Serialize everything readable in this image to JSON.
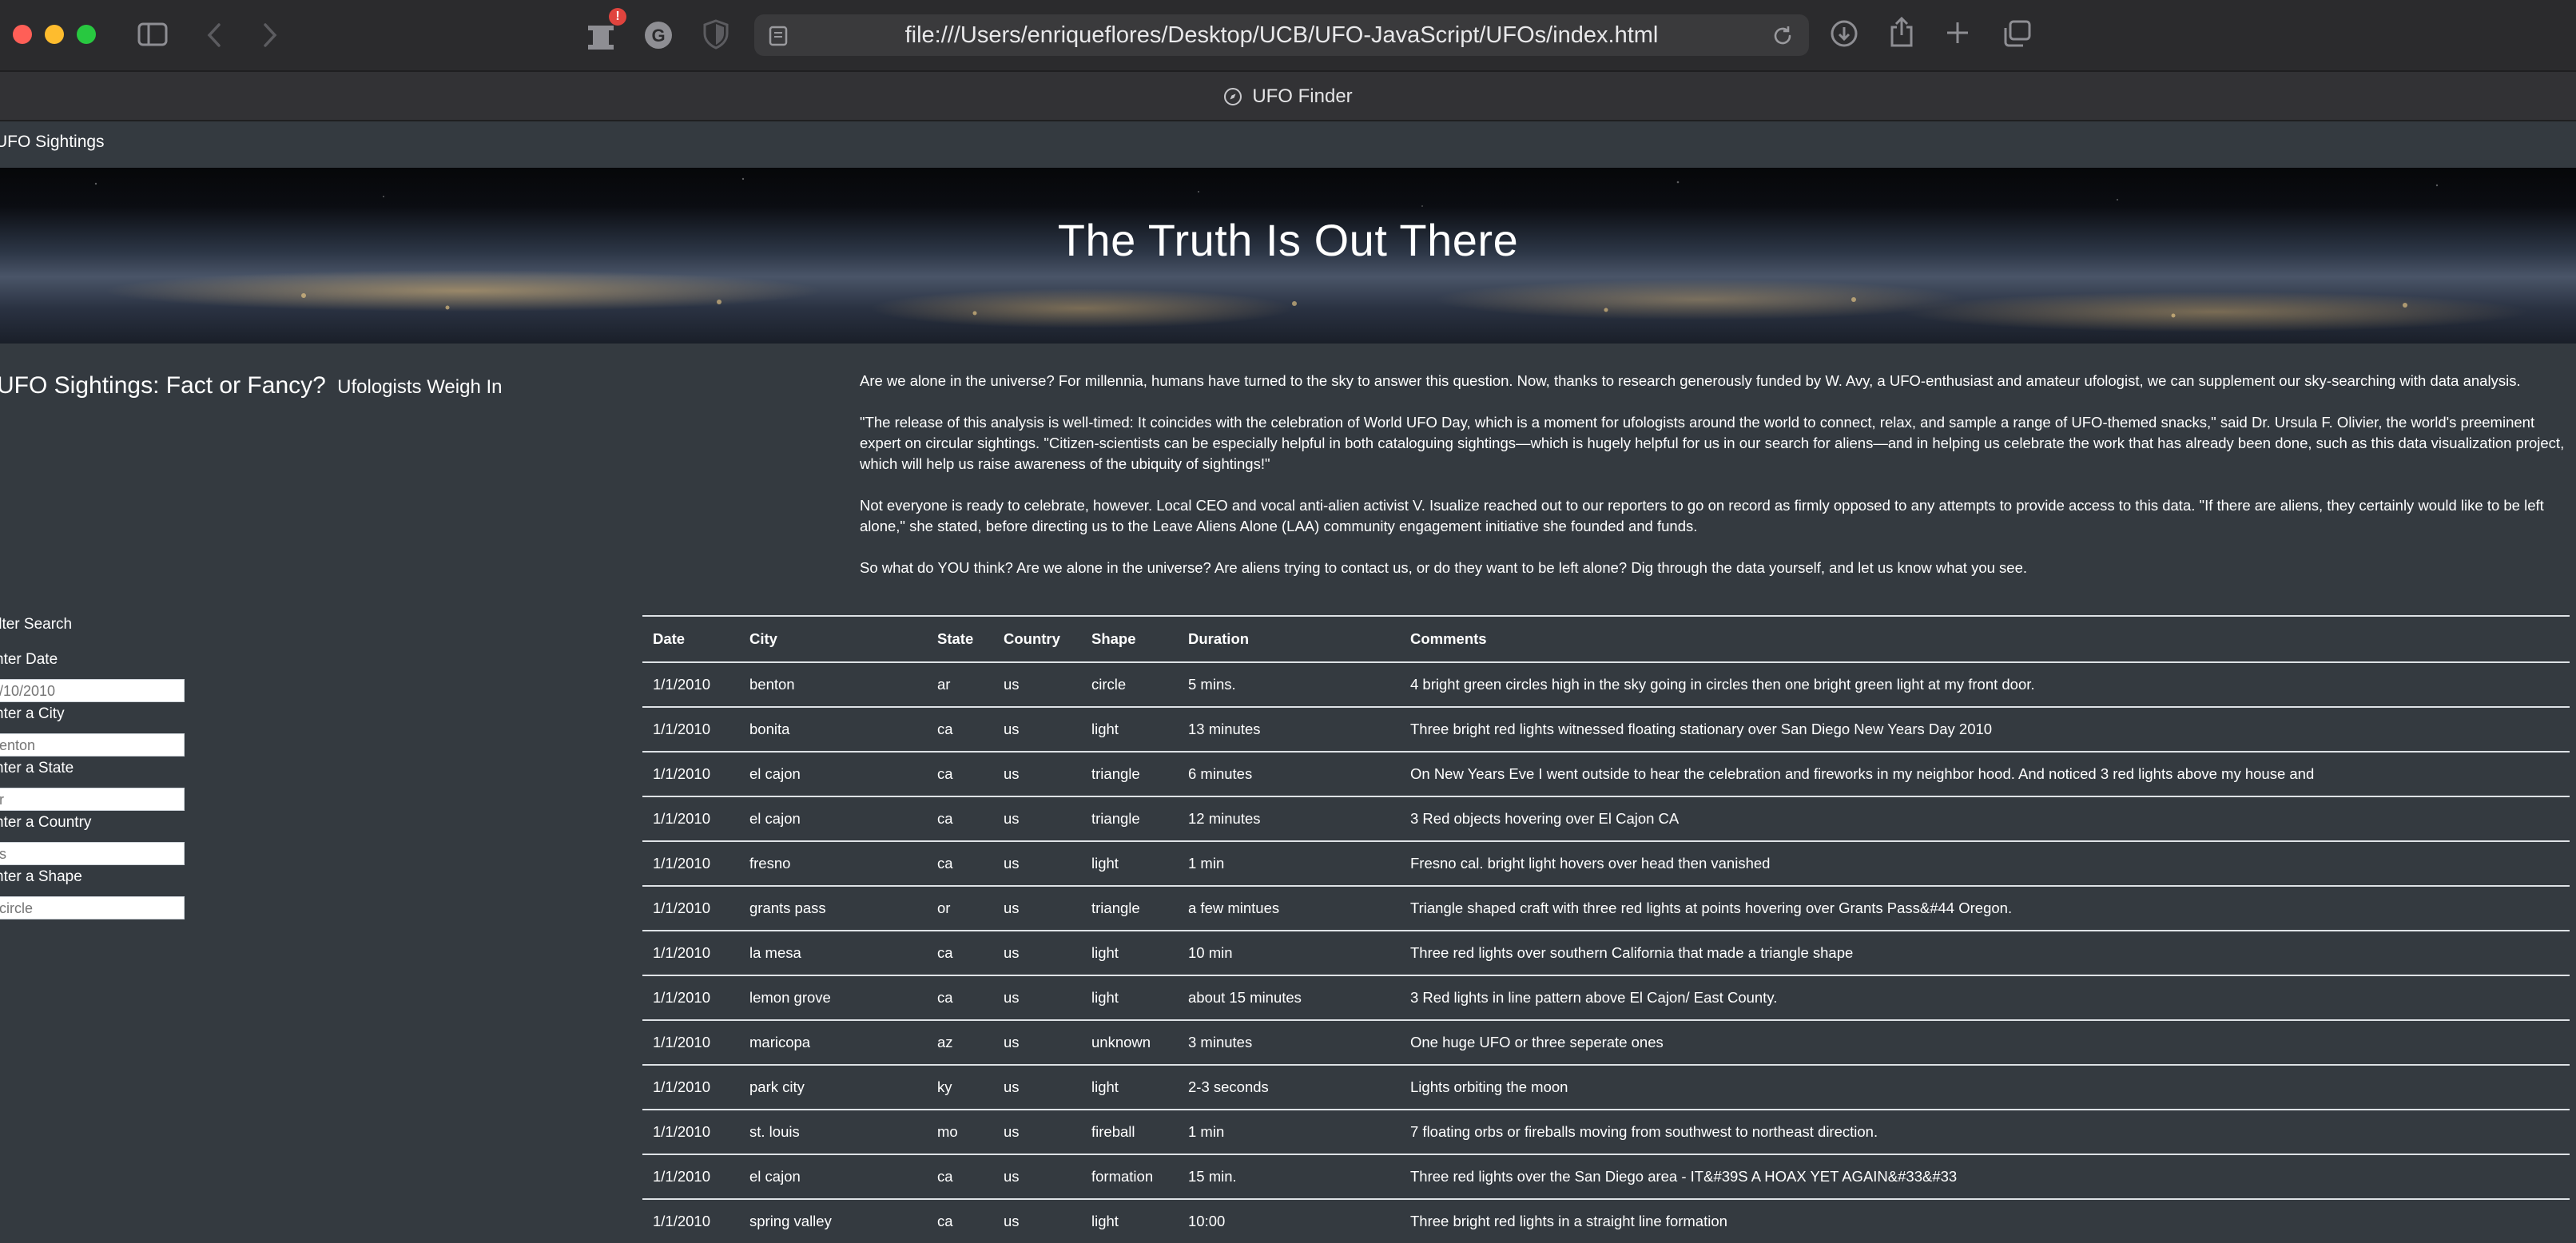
{
  "browser": {
    "url": "file:///Users/enriqueflores/Desktop/UCB/UFO-JavaScript/UFOs/index.html",
    "tab_title": "UFO Finder",
    "notification_badge": "!"
  },
  "navbar": {
    "brand": "UFO Sightings"
  },
  "jumbotron": {
    "title": "The Truth Is Out There"
  },
  "article": {
    "title": "UFO Sightings: Fact or Fancy?",
    "subtitle": "Ufologists Weigh In",
    "paragraphs": [
      "Are we alone in the universe? For millennia, humans have turned to the sky to answer this question. Now, thanks to research generously funded by W. Avy, a UFO-enthusiast and amateur ufologist, we can supplement our sky-searching with data analysis.",
      "\"The release of this analysis is well-timed: It coincides with the celebration of World UFO Day, which is a moment for ufologists around the world to connect, relax, and sample a range of UFO-themed snacks,\" said Dr. Ursula F. Olivier, the world's preeminent expert on circular sightings. \"Citizen-scientists can be especially helpful in both cataloguing sightings—which is hugely helpful for us in our search for aliens—and in helping us celebrate the work that has already been done, such as this data visualization project, which will help us raise awareness of the ubiquity of sightings!\"",
      "Not everyone is ready to celebrate, however. Local CEO and vocal anti-alien activist V. Isualize reached out to our reporters to go on record as firmly opposed to any attempts to provide access to this data. \"If there are aliens, they certainly would like to be left alone,\" she stated, before directing us to the Leave Aliens Alone (LAA) community engagement initiative she founded and funds.",
      "So what do YOU think? Are we alone in the universe? Are aliens trying to contact us, or do they want to be left alone? Dig through the data yourself, and let us know what you see."
    ]
  },
  "filters": {
    "heading": "ilter Search",
    "fields": [
      {
        "label": "nter Date",
        "placeholder": "/10/2010"
      },
      {
        "label": "nter a City",
        "placeholder": "enton"
      },
      {
        "label": "nter a State",
        "placeholder": "r"
      },
      {
        "label": "nter a Country",
        "placeholder": "s"
      },
      {
        "label": "nter a Shape",
        "placeholder": "circle"
      }
    ]
  },
  "table": {
    "headers": [
      "Date",
      "City",
      "State",
      "Country",
      "Shape",
      "Duration",
      "Comments"
    ],
    "rows": [
      [
        "1/1/2010",
        "benton",
        "ar",
        "us",
        "circle",
        "5 mins.",
        "4 bright green circles high in the sky going in circles then one bright green light at my front door."
      ],
      [
        "1/1/2010",
        "bonita",
        "ca",
        "us",
        "light",
        "13 minutes",
        "Three bright red lights witnessed floating stationary over San Diego New Years Day 2010"
      ],
      [
        "1/1/2010",
        "el cajon",
        "ca",
        "us",
        "triangle",
        "6 minutes",
        "On New Years Eve I went outside to hear the celebration and fireworks in my neighbor hood. And noticed 3 red lights above my house and"
      ],
      [
        "1/1/2010",
        "el cajon",
        "ca",
        "us",
        "triangle",
        "12 minutes",
        "3 Red objects hovering over El Cajon CA"
      ],
      [
        "1/1/2010",
        "fresno",
        "ca",
        "us",
        "light",
        "1 min",
        "Fresno cal. bright light hovers over head then vanished"
      ],
      [
        "1/1/2010",
        "grants pass",
        "or",
        "us",
        "triangle",
        "a few mintues",
        "Triangle shaped craft with three red lights at points hovering over Grants Pass&#44 Oregon."
      ],
      [
        "1/1/2010",
        "la mesa",
        "ca",
        "us",
        "light",
        "10 min",
        "Three red lights over southern California that made a triangle shape"
      ],
      [
        "1/1/2010",
        "lemon grove",
        "ca",
        "us",
        "light",
        "about 15 minutes",
        "3 Red lights in line pattern above El Cajon/ East County."
      ],
      [
        "1/1/2010",
        "maricopa",
        "az",
        "us",
        "unknown",
        "3 minutes",
        "One huge UFO or three seperate ones"
      ],
      [
        "1/1/2010",
        "park city",
        "ky",
        "us",
        "light",
        "2-3 seconds",
        "Lights orbiting the moon"
      ],
      [
        "1/1/2010",
        "st. louis",
        "mo",
        "us",
        "fireball",
        "1 min",
        "7 floating orbs or fireballs moving from southwest to northeast direction."
      ],
      [
        "1/1/2010",
        "el cajon",
        "ca",
        "us",
        "formation",
        "15 min.",
        "Three red lights over the San Diego area - IT&#39S A HOAX YET AGAIN&#33&#33"
      ],
      [
        "1/1/2010",
        "spring valley",
        "ca",
        "us",
        "light",
        "10:00",
        "Three bright red lights in a straight line formation"
      ]
    ]
  }
}
